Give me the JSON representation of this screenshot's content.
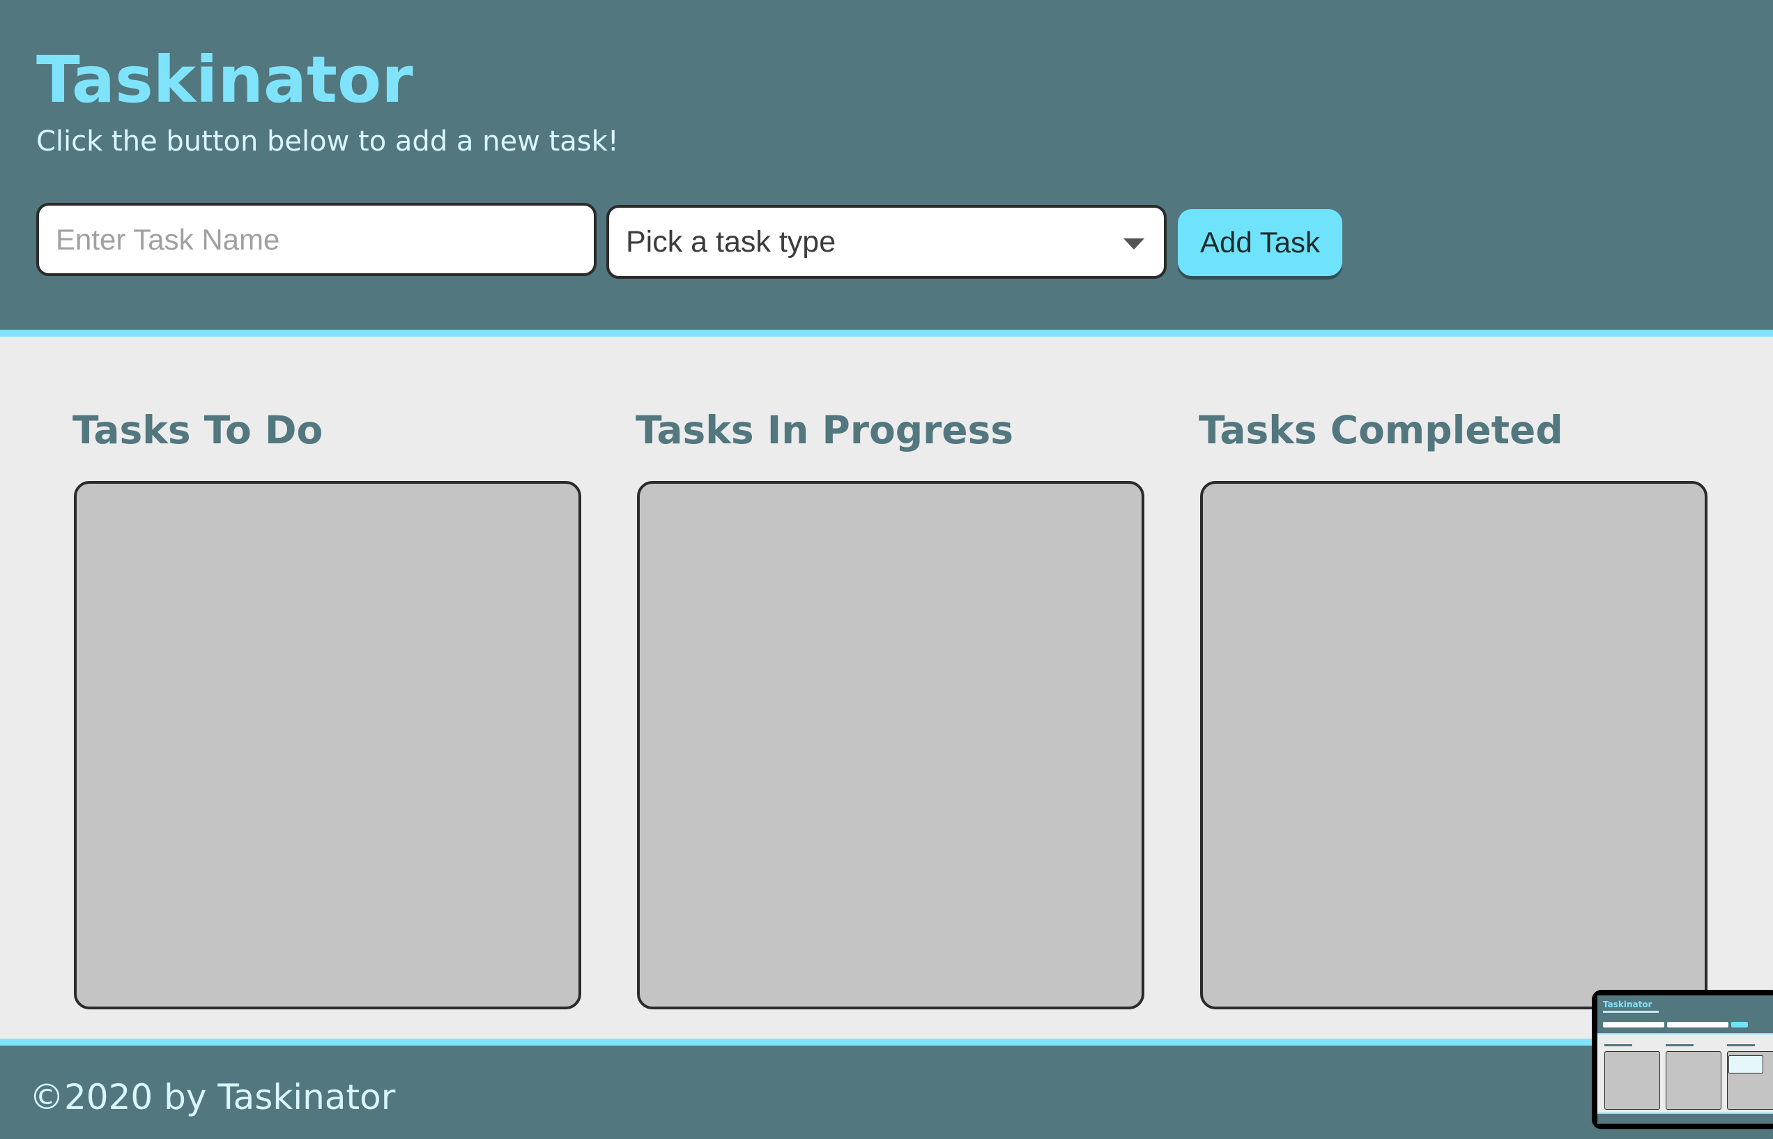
{
  "header": {
    "title": "Taskinator",
    "subtitle": "Click the button below to add a new task!"
  },
  "form": {
    "task_name_placeholder": "Enter Task Name",
    "task_type_selected": "Pick a task type",
    "add_button_label": "Add Task"
  },
  "columns": [
    {
      "heading": "Tasks To Do"
    },
    {
      "heading": "Tasks In Progress"
    },
    {
      "heading": "Tasks Completed"
    }
  ],
  "footer": {
    "text": "©2020 by Taskinator"
  },
  "preview": {
    "title": "Taskinator"
  },
  "colors": {
    "primary": "#52777e",
    "accent": "#7fe4fb",
    "background": "#ececec",
    "list_background": "#c4c4c4"
  }
}
